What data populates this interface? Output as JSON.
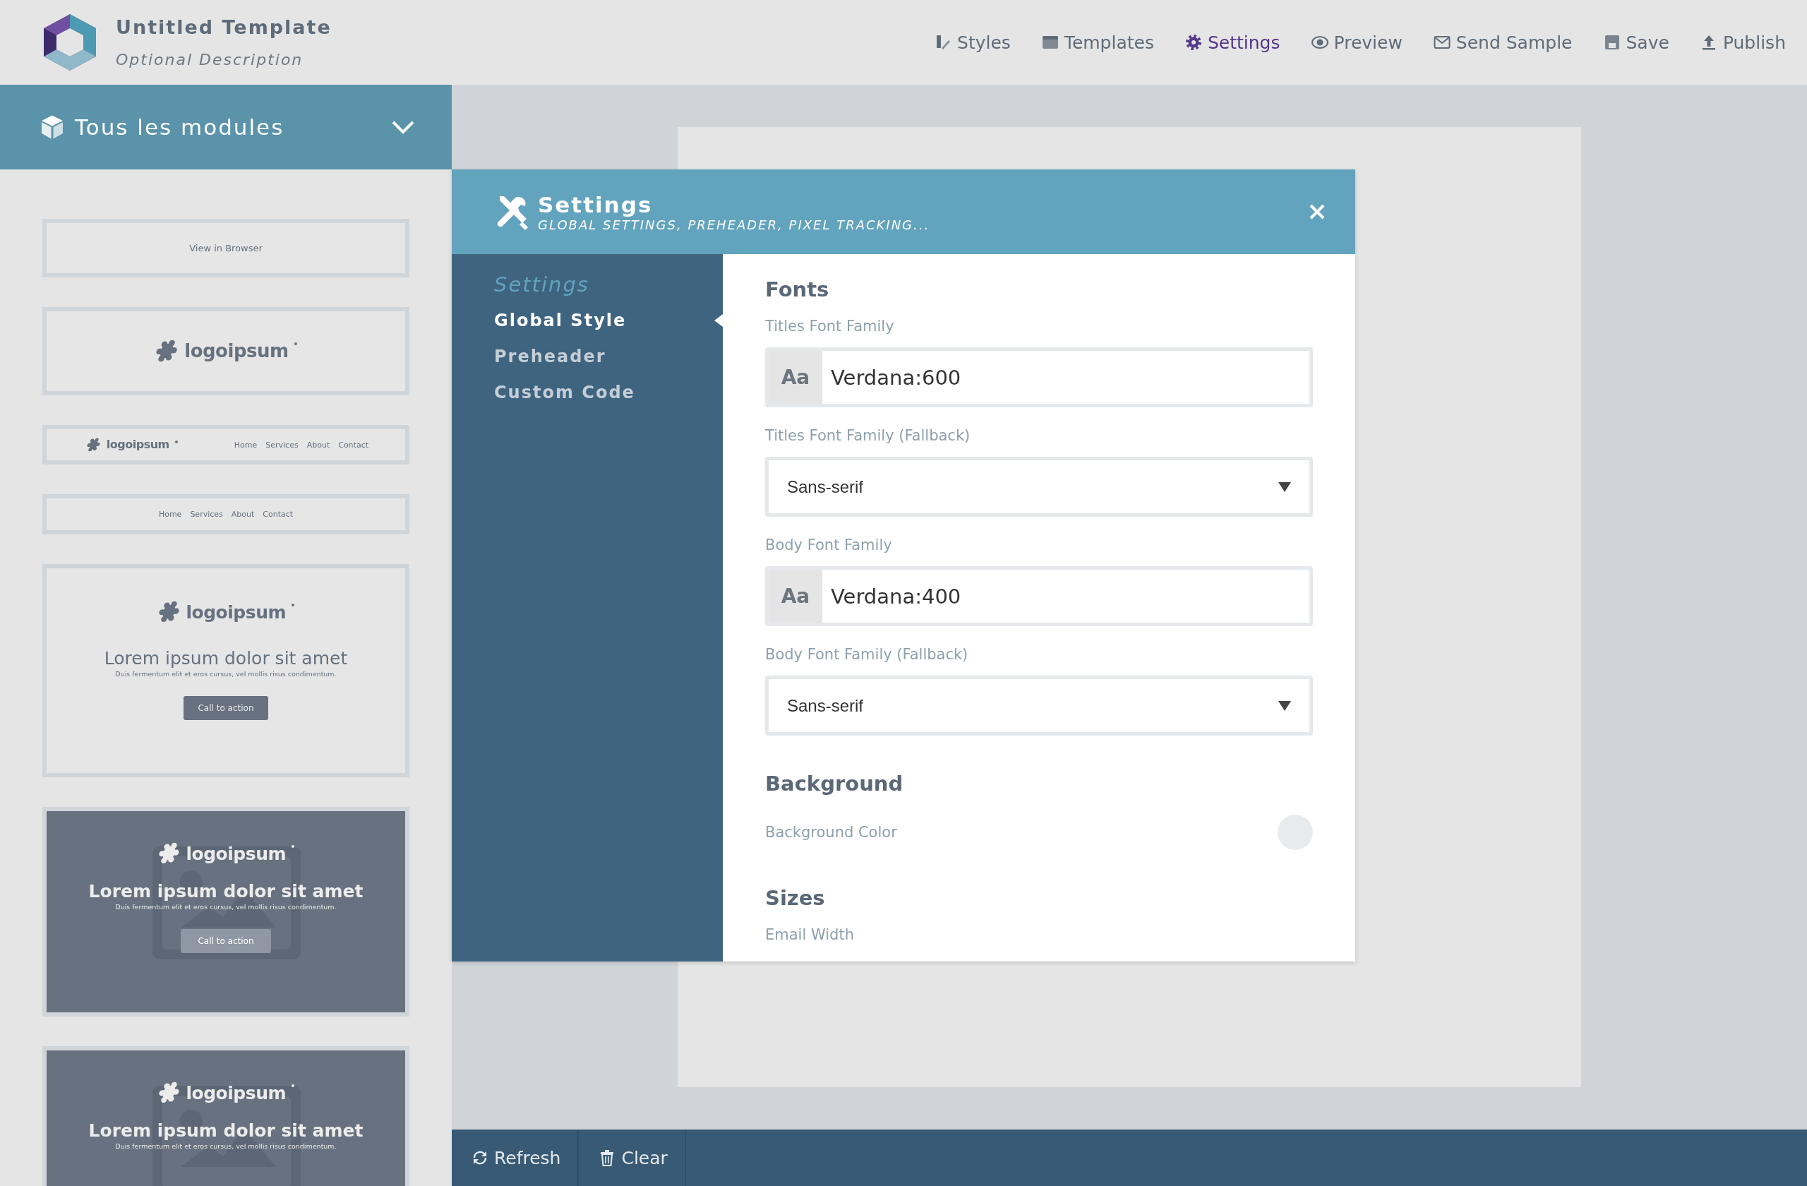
{
  "header": {
    "title": "Untitled Template",
    "description": "Optional Description"
  },
  "toolbar": {
    "items": [
      {
        "label": "Styles",
        "selected": false
      },
      {
        "label": "Templates",
        "selected": false
      },
      {
        "label": "Settings",
        "selected": true
      },
      {
        "label": "Preview",
        "selected": false
      },
      {
        "label": "Send Sample",
        "selected": false
      },
      {
        "label": "Save",
        "selected": false
      },
      {
        "label": "Publish",
        "selected": false
      }
    ]
  },
  "sidebar": {
    "title": "Tous les modules",
    "modules": [
      {
        "kind": "text",
        "text": "View in Browser"
      },
      {
        "kind": "logo",
        "logo": "logoipsum"
      },
      {
        "kind": "logo_nav",
        "logo": "logoipsum",
        "links": [
          "Home",
          "Services",
          "About",
          "Contact"
        ]
      },
      {
        "kind": "nav",
        "links": [
          "Home",
          "Services",
          "About",
          "Contact"
        ]
      },
      {
        "kind": "hero",
        "logo": "logoipsum",
        "title": "Lorem ipsum dolor sit amet",
        "subtitle": "Duis fermentum elit et eros cursus, vel mollis risus condimentum.",
        "button": "Call to action"
      },
      {
        "kind": "image_hero",
        "logo": "logoipsum",
        "title": "Lorem ipsum dolor sit amet",
        "subtitle": "Duis fermentum elit et eros cursus, vel mollis risus condimentum.",
        "button": "Call to action"
      },
      {
        "kind": "image_hero",
        "logo": "logoipsum",
        "title": "Lorem ipsum dolor sit amet",
        "subtitle": "Duis fermentum elit et eros cursus, vel mollis risus condimentum."
      }
    ]
  },
  "modal": {
    "title": "Settings",
    "subtitle": "GLOBAL SETTINGS, PREHEADER, PIXEL TRACKING...",
    "nav": {
      "heading": "Settings",
      "items": [
        {
          "label": "Global Style",
          "selected": true
        },
        {
          "label": "Preheader",
          "selected": false
        },
        {
          "label": "Custom Code",
          "selected": false
        }
      ]
    },
    "sections": [
      {
        "heading": "Fonts",
        "fields": [
          {
            "kind": "font",
            "label": "Titles Font Family",
            "prefix": "Aa",
            "value": "Verdana:600"
          },
          {
            "kind": "select",
            "label": "Titles Font Family (Fallback)",
            "value": "Sans-serif"
          },
          {
            "kind": "font",
            "label": "Body Font Family",
            "prefix": "Aa",
            "value": "Verdana:400"
          },
          {
            "kind": "select",
            "label": "Body Font Family (Fallback)",
            "value": "Sans-serif"
          }
        ]
      },
      {
        "heading": "Background",
        "fields": [
          {
            "kind": "color",
            "label": "Background Color",
            "color": "#e8ebee"
          }
        ]
      },
      {
        "heading": "Sizes",
        "fields": [
          {
            "kind": "label",
            "label": "Email Width"
          }
        ]
      }
    ]
  },
  "footer": {
    "buttons": [
      {
        "label": "Refresh"
      },
      {
        "label": "Clear"
      }
    ]
  }
}
